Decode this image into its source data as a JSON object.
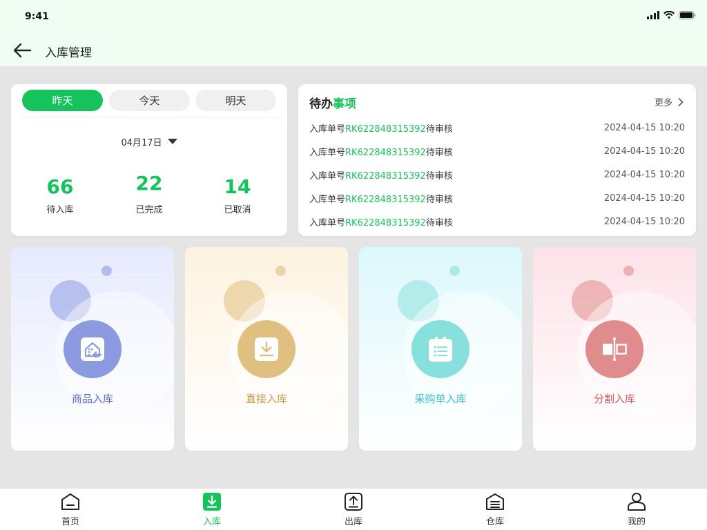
{
  "status_bar": {
    "time": "9:41"
  },
  "header": {
    "title": "入库管理"
  },
  "stats": {
    "tabs": [
      {
        "label": "昨天",
        "active": true
      },
      {
        "label": "今天",
        "active": false
      },
      {
        "label": "明天",
        "active": false
      }
    ],
    "date": "04月17日",
    "items": [
      {
        "value": "66",
        "label": "待入库"
      },
      {
        "value": "22",
        "label": "已完成"
      },
      {
        "value": "14",
        "label": "已取消"
      }
    ]
  },
  "todo": {
    "title_part1": "待办",
    "title_part2": "事项",
    "more_label": "更多",
    "rows": [
      {
        "prefix": "入库单号",
        "number": "RK622848315392",
        "suffix": "待审核",
        "time": "2024-04-15  10:20"
      },
      {
        "prefix": "入库单号",
        "number": "RK622848315392",
        "suffix": "待审核",
        "time": "2024-04-15  10:20"
      },
      {
        "prefix": "入库单号",
        "number": "RK622848315392",
        "suffix": "待审核",
        "time": "2024-04-15  10:20"
      },
      {
        "prefix": "入库单号",
        "number": "RK622848315392",
        "suffix": "待审核",
        "time": "2024-04-15  10:20"
      },
      {
        "prefix": "入库单号",
        "number": "RK622848315392",
        "suffix": "待审核",
        "time": "2024-04-15  10:20"
      }
    ]
  },
  "tiles": [
    {
      "label": "商品入库",
      "icon": "goods-inbound-icon",
      "color": "#8c9be0",
      "text_color": "#5566c4",
      "bg_top": "#e6eafd"
    },
    {
      "label": "直接入库",
      "icon": "download-icon",
      "color": "#e0c080",
      "text_color": "#c4973f",
      "bg_top": "#fdf3e0"
    },
    {
      "label": "采购单入库",
      "icon": "purchase-order-icon",
      "color": "#88e0dc",
      "text_color": "#3bbfc4",
      "bg_top": "#dcf8fb"
    },
    {
      "label": "分割入库",
      "icon": "split-icon",
      "color": "#e08c8c",
      "text_color": "#d45555",
      "bg_top": "#fde2e8"
    }
  ],
  "bottom_nav": [
    {
      "label": "首页",
      "icon": "home-icon",
      "active": false
    },
    {
      "label": "入库",
      "icon": "inbound-icon",
      "active": true
    },
    {
      "label": "出库",
      "icon": "outbound-icon",
      "active": false
    },
    {
      "label": "仓库",
      "icon": "warehouse-icon",
      "active": false
    },
    {
      "label": "我的",
      "icon": "profile-icon",
      "active": false
    }
  ],
  "colors": {
    "primary": "#16c25a",
    "header_bg": "#effdf3",
    "page_bg": "#e5e5e5"
  }
}
